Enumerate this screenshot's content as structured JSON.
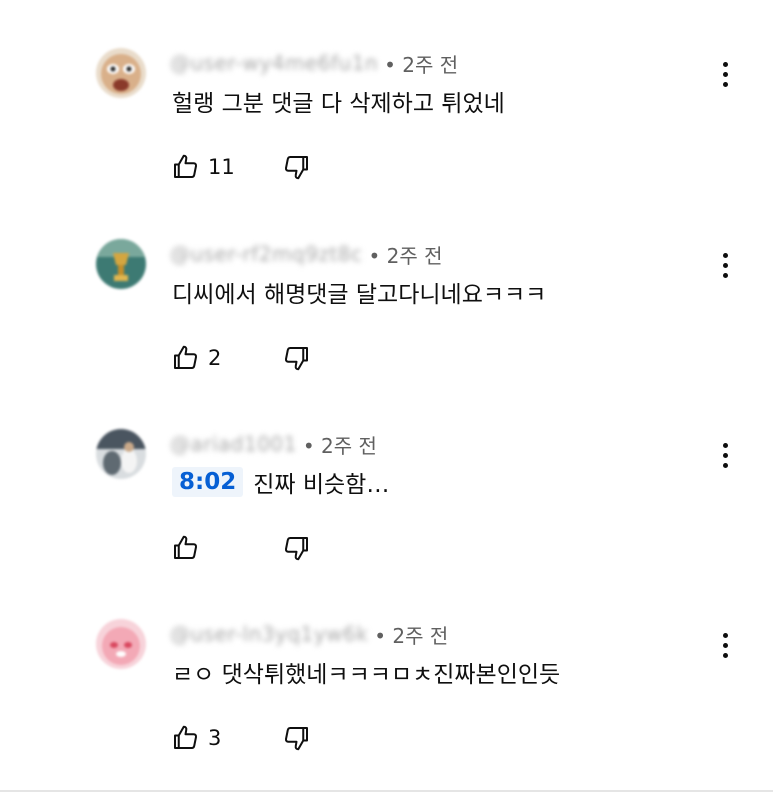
{
  "comments": [
    {
      "handle": "@user-wy4me6fu1n",
      "time_label": "• 2주 전",
      "timestamp_link": "",
      "text": "헐랭 그분 댓글 다 삭제하고 튀었네",
      "likes": "11",
      "avatar_colors": [
        "#d9b08a",
        "#8a5a3a"
      ],
      "avatar_icon": "avatar-cartoon-face"
    },
    {
      "handle": "@user-rf2mq9zt8c",
      "time_label": "• 2주 전",
      "timestamp_link": "",
      "text": "디씨에서 해명댓글 달고다니네요ㅋㅋㅋ",
      "likes": "2",
      "avatar_colors": [
        "#3d7a73",
        "#d4a640"
      ],
      "avatar_icon": "avatar-trophy"
    },
    {
      "handle": "@ariad1001",
      "time_label": "• 2주 전",
      "timestamp_link": "8:02",
      "text": "진짜 비슷함…",
      "likes": "",
      "avatar_colors": [
        "#4a5560",
        "#e8e8e8"
      ],
      "avatar_icon": "avatar-photo"
    },
    {
      "handle": "@user-ln3yq1yw6k",
      "time_label": "• 2주 전",
      "timestamp_link": "",
      "text": "ㄹㅇ 댓삭튀했네ㅋㅋㅋㅁㅊ진짜본인인듯",
      "likes": "3",
      "avatar_colors": [
        "#f3a9b6",
        "#d9485f"
      ],
      "avatar_icon": "avatar-pink-character"
    }
  ],
  "icons": {
    "like": "thumbs-up-icon",
    "dislike": "thumbs-down-icon",
    "more": "more-vertical-icon"
  }
}
